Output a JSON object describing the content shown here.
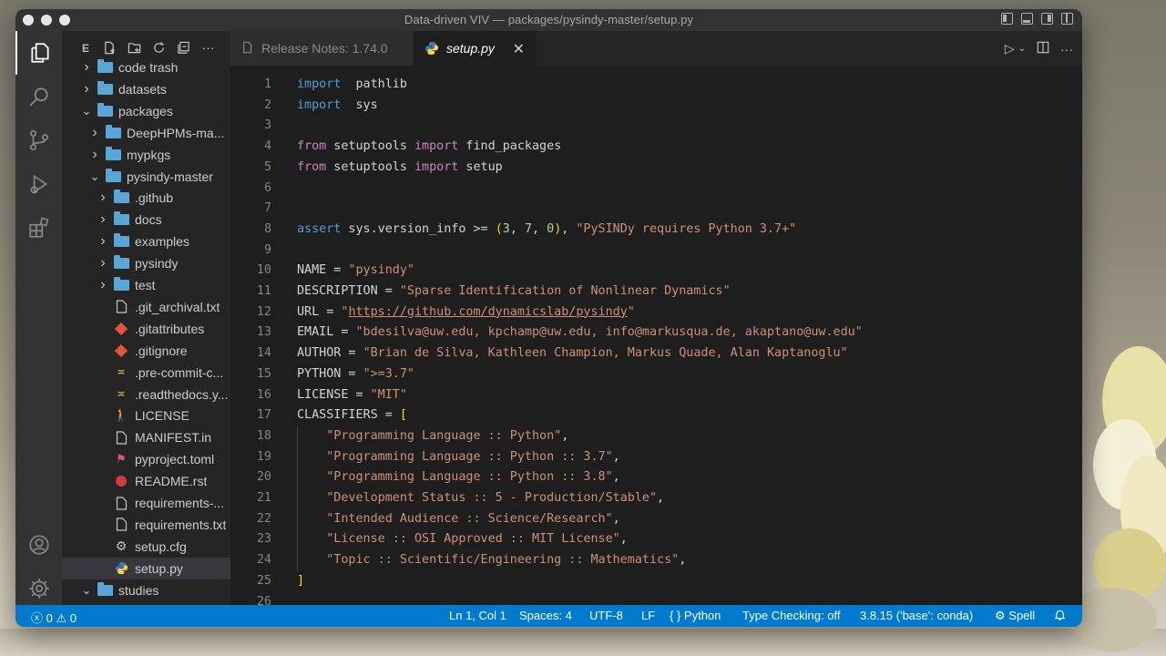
{
  "window": {
    "title": "Data-driven VIV — packages/pysindy-master/setup.py"
  },
  "sidebar": {
    "title": "E",
    "tree": [
      {
        "label": "code trash",
        "type": "folder",
        "depth": 1,
        "expanded": false
      },
      {
        "label": "datasets",
        "type": "folder",
        "depth": 1,
        "expanded": false
      },
      {
        "label": "packages",
        "type": "folder",
        "depth": 1,
        "expanded": true
      },
      {
        "label": "DeepHPMs-ma...",
        "type": "folder",
        "depth": 2,
        "expanded": false
      },
      {
        "label": "mypkgs",
        "type": "folder",
        "depth": 2,
        "expanded": false
      },
      {
        "label": "pysindy-master",
        "type": "folder",
        "depth": 2,
        "expanded": true
      },
      {
        "label": ".github",
        "type": "folder",
        "depth": 3,
        "expanded": false
      },
      {
        "label": "docs",
        "type": "folder",
        "depth": 3,
        "expanded": false
      },
      {
        "label": "examples",
        "type": "folder",
        "depth": 3,
        "expanded": false
      },
      {
        "label": "pysindy",
        "type": "folder",
        "depth": 3,
        "expanded": false
      },
      {
        "label": "test",
        "type": "folder",
        "depth": 3,
        "expanded": false
      },
      {
        "label": ".git_archival.txt",
        "type": "file",
        "depth": 3,
        "icon": "file"
      },
      {
        "label": ".gitattributes",
        "type": "file",
        "depth": 3,
        "icon": "git"
      },
      {
        "label": ".gitignore",
        "type": "file",
        "depth": 3,
        "icon": "git"
      },
      {
        "label": ".pre-commit-c...",
        "type": "file",
        "depth": 3,
        "icon": "yaml"
      },
      {
        "label": ".readthedocs.y...",
        "type": "file",
        "depth": 3,
        "icon": "yaml"
      },
      {
        "label": "LICENSE",
        "type": "file",
        "depth": 3,
        "icon": "license"
      },
      {
        "label": "MANIFEST.in",
        "type": "file",
        "depth": 3,
        "icon": "file"
      },
      {
        "label": "pyproject.toml",
        "type": "file",
        "depth": 3,
        "icon": "toml"
      },
      {
        "label": "README.rst",
        "type": "file",
        "depth": 3,
        "icon": "rst"
      },
      {
        "label": "requirements-...",
        "type": "file",
        "depth": 3,
        "icon": "file"
      },
      {
        "label": "requirements.txt",
        "type": "file",
        "depth": 3,
        "icon": "file"
      },
      {
        "label": "setup.cfg",
        "type": "file",
        "depth": 3,
        "icon": "gear"
      },
      {
        "label": "setup.py",
        "type": "file",
        "depth": 3,
        "icon": "python",
        "selected": true
      },
      {
        "label": "studies",
        "type": "folder",
        "depth": 1,
        "expanded": true
      }
    ]
  },
  "tabs": [
    {
      "label": "Release Notes: 1.74.0",
      "active": false
    },
    {
      "label": "setup.py",
      "active": true
    }
  ],
  "editor": {
    "lines": [
      [
        [
          "kw",
          "import"
        ],
        [
          "",
          "  pathlib"
        ]
      ],
      [
        [
          "kw",
          "import"
        ],
        [
          "",
          "  sys"
        ]
      ],
      [],
      [
        [
          "kwc",
          "from"
        ],
        [
          "",
          " setuptools "
        ],
        [
          "kwc",
          "import"
        ],
        [
          "",
          " find_packages"
        ]
      ],
      [
        [
          "kwc",
          "from"
        ],
        [
          "",
          " setuptools "
        ],
        [
          "kwc",
          "import"
        ],
        [
          "",
          " setup"
        ]
      ],
      [],
      [],
      [
        [
          "kw",
          "assert"
        ],
        [
          "",
          " sys.version_info >= "
        ],
        [
          "br",
          "("
        ],
        [
          "num",
          "3"
        ],
        [
          "",
          ", "
        ],
        [
          "num",
          "7"
        ],
        [
          "",
          ", "
        ],
        [
          "num",
          "0"
        ],
        [
          "br",
          ")"
        ],
        [
          "",
          ", "
        ],
        [
          "str",
          "\"PySINDy requires Python 3.7+\""
        ]
      ],
      [],
      [
        [
          "",
          "NAME = "
        ],
        [
          "str",
          "\"pysindy\""
        ]
      ],
      [
        [
          "",
          "DESCRIPTION = "
        ],
        [
          "str",
          "\"Sparse Identification of Nonlinear Dynamics\""
        ]
      ],
      [
        [
          "",
          "URL = "
        ],
        [
          "str",
          "\""
        ],
        [
          "url",
          "https://github.com/dynamicslab/pysindy"
        ],
        [
          "str",
          "\""
        ]
      ],
      [
        [
          "",
          "EMAIL = "
        ],
        [
          "str",
          "\"bdesilva@uw.edu, kpchamp@uw.edu, info@markusqua.de, akaptano@uw.edu\""
        ]
      ],
      [
        [
          "",
          "AUTHOR = "
        ],
        [
          "str",
          "\"Brian de Silva, Kathleen Champion, Markus Quade, Alan Kaptanoglu\""
        ]
      ],
      [
        [
          "",
          "PYTHON = "
        ],
        [
          "str",
          "\">=3.7\""
        ]
      ],
      [
        [
          "",
          "LICENSE = "
        ],
        [
          "str",
          "\"MIT\""
        ]
      ],
      [
        [
          "",
          "CLASSIFIERS = "
        ],
        [
          "br",
          "["
        ]
      ],
      [
        [
          "",
          "    "
        ],
        [
          "str",
          "\"Programming Language :: Python\""
        ],
        [
          "",
          ","
        ]
      ],
      [
        [
          "",
          "    "
        ],
        [
          "str",
          "\"Programming Language :: Python :: 3.7\""
        ],
        [
          "",
          ","
        ]
      ],
      [
        [
          "",
          "    "
        ],
        [
          "str",
          "\"Programming Language :: Python :: 3.8\""
        ],
        [
          "",
          ","
        ]
      ],
      [
        [
          "",
          "    "
        ],
        [
          "str",
          "\"Development Status :: 5 - Production/Stable\""
        ],
        [
          "",
          ","
        ]
      ],
      [
        [
          "",
          "    "
        ],
        [
          "str",
          "\"Intended Audience :: Science/Research\""
        ],
        [
          "",
          ","
        ]
      ],
      [
        [
          "",
          "    "
        ],
        [
          "str",
          "\"License :: OSI Approved :: MIT License\""
        ],
        [
          "",
          ","
        ]
      ],
      [
        [
          "",
          "    "
        ],
        [
          "str",
          "\"Topic :: Scientific/Engineering :: Mathematics\""
        ],
        [
          "",
          ","
        ]
      ],
      [
        [
          "br",
          "]"
        ]
      ],
      []
    ]
  },
  "statusbar": {
    "errors": "0",
    "warnings": "0",
    "cursor": "Ln 1, Col 1",
    "spaces": "Spaces: 4",
    "encoding": "UTF-8",
    "eol": "LF",
    "language": "Python",
    "type_checking": "Type Checking: off",
    "interpreter": "3.8.15 ('base': conda)",
    "spell": "Spell"
  },
  "colors": {
    "accent": "#007acc",
    "keyword": "#569cd6",
    "keyword_control": "#c586c0",
    "string": "#ce9178",
    "number": "#b5cea8"
  }
}
